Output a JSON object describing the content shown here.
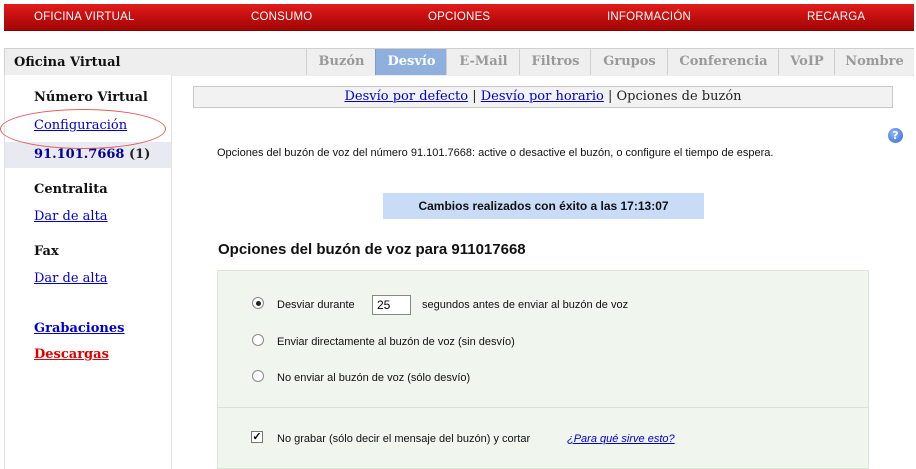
{
  "topnav": {
    "items": [
      "OFICINA VIRTUAL",
      "CONSUMO",
      "OPCIONES",
      "INFORMACIÓN",
      "RECARGA"
    ]
  },
  "panel": {
    "title": "Oficina Virtual",
    "tabs": [
      "Buzón",
      "Desvío",
      "E-Mail",
      "Filtros",
      "Grupos",
      "Conferencia",
      "VoIP",
      "Nombre"
    ],
    "active_tab": "Desvío"
  },
  "sidebar": {
    "section_virtual": "Número Virtual",
    "config_link": "Configuración",
    "number": "91.101.7668",
    "number_count": "(1)",
    "section_centralita": "Centralita",
    "centralita_link": "Dar de alta",
    "section_fax": "Fax",
    "fax_link": "Dar de alta",
    "recordings_link": "Grabaciones",
    "downloads_link": "Descargas"
  },
  "subnav": {
    "link_default": "Desvío por defecto",
    "separator": "|",
    "link_schedule": "Desvío por horario",
    "current": "Opciones de buzón"
  },
  "content": {
    "help_glyph": "?",
    "description": "Opciones del buzón de voz del número 91.101.7668: active o desactive el buzón, o configure el tiempo de espera.",
    "success_message": "Cambios realizados con éxito a las 17:13:07",
    "heading": "Opciones del buzón de voz para 911017668"
  },
  "options": {
    "divert_before": "Desviar durante",
    "seconds_value": "25",
    "divert_after": "segundos antes de enviar al buzón de voz",
    "direct": "Enviar directamente al buzón de voz (sin desvío)",
    "no_send": "No enviar al buzón de voz (sólo desvío)",
    "selected": "divert",
    "no_record_label": "No grabar (sólo decir el mensaje del buzón) y cortar",
    "no_record_checked": true,
    "help_link": "¿Para qué sirve esto?"
  }
}
